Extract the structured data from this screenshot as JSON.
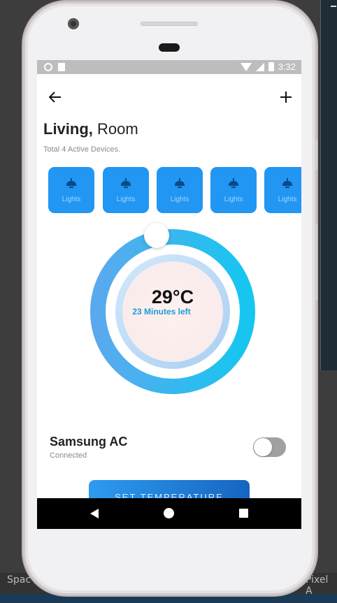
{
  "header": {
    "title_bold": "Living,",
    "title_rest": " Room",
    "subtitle": "Total 4 Active Devices."
  },
  "status_bar": {
    "time": "3:32"
  },
  "devices": [
    {
      "label": "Lights"
    },
    {
      "label": "Lights"
    },
    {
      "label": "Lights"
    },
    {
      "label": "Lights"
    },
    {
      "label": "Lights"
    }
  ],
  "thermostat": {
    "temperature": "29°C",
    "time_left": "23 Minutes left"
  },
  "ac": {
    "name": "Samsung AC",
    "status": "Connected",
    "enabled": false
  },
  "action": {
    "label": "SET TEMPERATURE"
  },
  "background": {
    "taskbar_left": "Spac",
    "taskbar_right": "Pixel A"
  },
  "colors": {
    "accent": "#2196f3",
    "dial_start": "#5aa9ee",
    "dial_end": "#16c6f0",
    "navbar": "#000000"
  }
}
